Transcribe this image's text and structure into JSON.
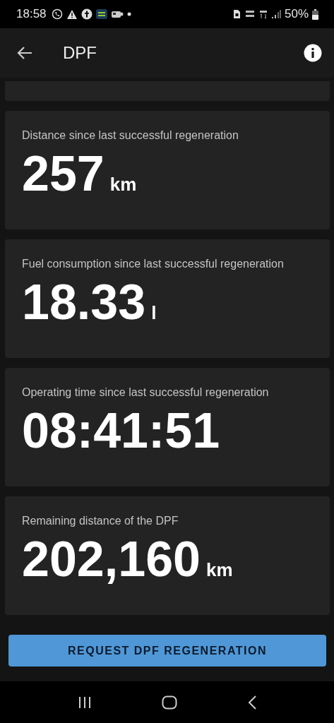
{
  "status_bar": {
    "time": "18:58",
    "battery": "50%"
  },
  "app_bar": {
    "title": "DPF"
  },
  "cards": [
    {
      "label": "Distance since last successful regeneration",
      "value": "257",
      "unit": "km"
    },
    {
      "label": "Fuel consumption since last successful regeneration",
      "value": "18.33",
      "unit": "l"
    },
    {
      "label": "Operating time since last successful regeneration",
      "value": "08:41:51"
    },
    {
      "label": "Remaining distance of the DPF",
      "value": "202,160",
      "unit": "km"
    }
  ],
  "button": {
    "label": "REQUEST DPF REGENERATION"
  }
}
